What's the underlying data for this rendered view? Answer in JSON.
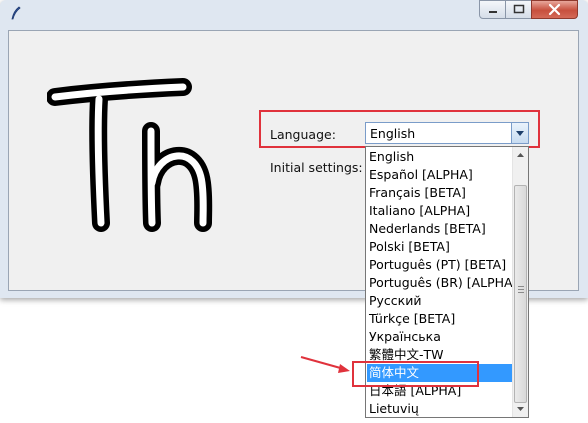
{
  "window": {
    "minimize_icon": "minimize-icon",
    "maximize_icon": "maximize-icon",
    "close_icon": "close-icon"
  },
  "form": {
    "language_label": "Language:",
    "initial_settings_label": "Initial settings:"
  },
  "language_select": {
    "selected": "English",
    "options": [
      "English",
      "Español [ALPHA]",
      "Français [BETA]",
      "Italiano [ALPHA]",
      "Nederlands [BETA]",
      "Polski [BETA]",
      "Português (PT) [BETA]",
      "Português (BR) [ALPHA]",
      "Русский",
      "Türkçe [BETA]",
      "Українська",
      "繁體中文-TW",
      "简体中文",
      "日本語 [ALPHA]",
      "Lietuvių"
    ],
    "highlighted": "简体中文"
  },
  "colors": {
    "highlight_border": "#e0323c",
    "selection": "#3399ff",
    "annotation_arrow": "#e0323c"
  }
}
